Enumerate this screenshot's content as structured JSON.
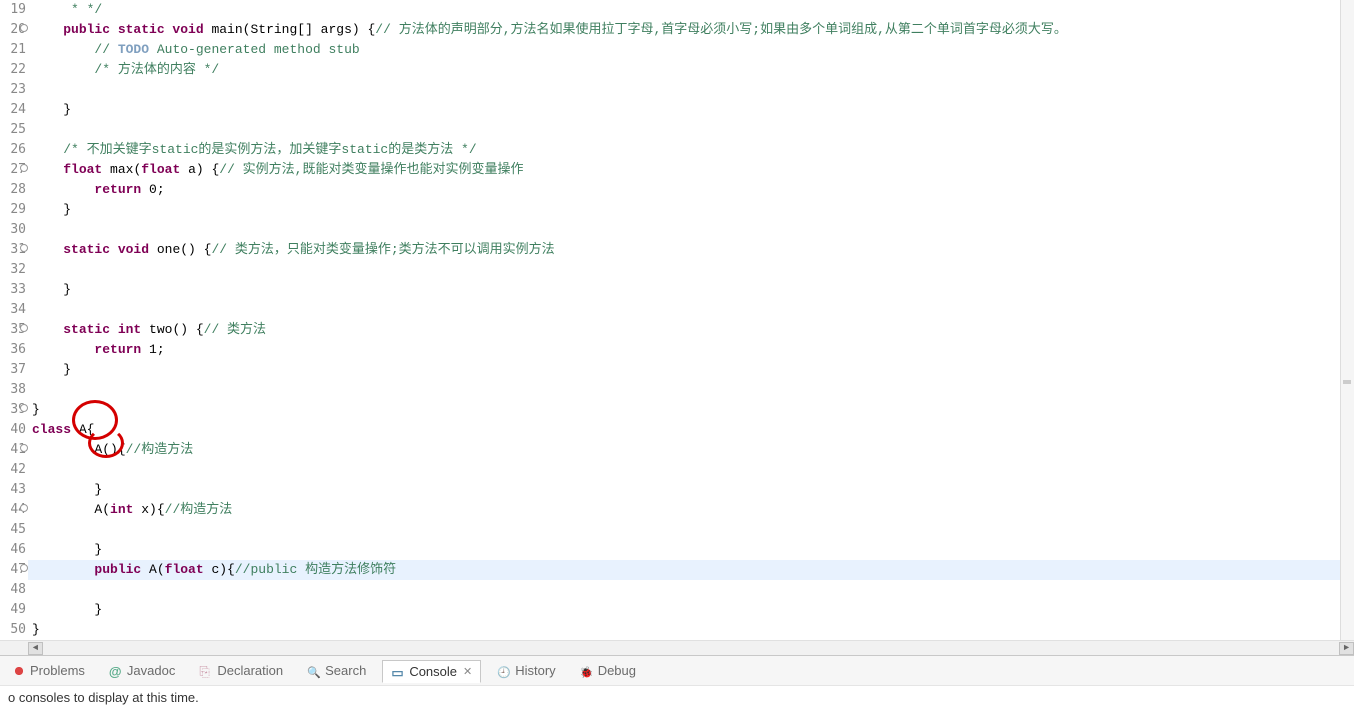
{
  "gutter": {
    "start": 19,
    "end": 50,
    "annotations": [
      20,
      27,
      31,
      35,
      39,
      41,
      44,
      47
    ]
  },
  "code": {
    "lines": [
      {
        "n": 19,
        "seg": [
          {
            "t": "     * */",
            "c": "cm"
          }
        ]
      },
      {
        "n": 20,
        "seg": [
          {
            "t": "    ",
            "c": "plain"
          },
          {
            "t": "public static void",
            "c": "kw"
          },
          {
            "t": " main(String[] args) {",
            "c": "plain"
          },
          {
            "t": "// 方法体的声明部分,方法名如果使用拉丁字母,首字母必须小写;如果由多个单词组成,从第二个单词首字母必须大写。",
            "c": "cm"
          }
        ]
      },
      {
        "n": 21,
        "seg": [
          {
            "t": "        ",
            "c": "plain"
          },
          {
            "t": "// ",
            "c": "cm"
          },
          {
            "t": "TODO",
            "c": "todo"
          },
          {
            "t": " Auto-generated method stub",
            "c": "cm"
          }
        ]
      },
      {
        "n": 22,
        "seg": [
          {
            "t": "        ",
            "c": "plain"
          },
          {
            "t": "/* 方法体的内容 */",
            "c": "cm"
          }
        ]
      },
      {
        "n": 23,
        "seg": [
          {
            "t": "",
            "c": "plain"
          }
        ]
      },
      {
        "n": 24,
        "seg": [
          {
            "t": "    }",
            "c": "plain"
          }
        ]
      },
      {
        "n": 25,
        "seg": [
          {
            "t": "",
            "c": "plain"
          }
        ]
      },
      {
        "n": 26,
        "seg": [
          {
            "t": "    ",
            "c": "plain"
          },
          {
            "t": "/* 不加关键字static的是实例方法，加关键字static的是类方法 */",
            "c": "cm"
          }
        ]
      },
      {
        "n": 27,
        "seg": [
          {
            "t": "    ",
            "c": "plain"
          },
          {
            "t": "float",
            "c": "kw"
          },
          {
            "t": " max(",
            "c": "plain"
          },
          {
            "t": "float",
            "c": "kw"
          },
          {
            "t": " a) {",
            "c": "plain"
          },
          {
            "t": "// 实例方法,既能对类变量操作也能对实例变量操作",
            "c": "cm"
          }
        ]
      },
      {
        "n": 28,
        "seg": [
          {
            "t": "        ",
            "c": "plain"
          },
          {
            "t": "return",
            "c": "kw"
          },
          {
            "t": " 0;",
            "c": "plain"
          }
        ]
      },
      {
        "n": 29,
        "seg": [
          {
            "t": "    }",
            "c": "plain"
          }
        ]
      },
      {
        "n": 30,
        "seg": [
          {
            "t": "",
            "c": "plain"
          }
        ]
      },
      {
        "n": 31,
        "seg": [
          {
            "t": "    ",
            "c": "plain"
          },
          {
            "t": "static void",
            "c": "kw"
          },
          {
            "t": " one() {",
            "c": "plain"
          },
          {
            "t": "// 类方法，只能对类变量操作;类方法不可以调用实例方法",
            "c": "cm"
          }
        ]
      },
      {
        "n": 32,
        "seg": [
          {
            "t": "",
            "c": "plain"
          }
        ]
      },
      {
        "n": 33,
        "seg": [
          {
            "t": "    }",
            "c": "plain"
          }
        ]
      },
      {
        "n": 34,
        "seg": [
          {
            "t": "",
            "c": "plain"
          }
        ]
      },
      {
        "n": 35,
        "seg": [
          {
            "t": "    ",
            "c": "plain"
          },
          {
            "t": "static int",
            "c": "kw"
          },
          {
            "t": " two() {",
            "c": "plain"
          },
          {
            "t": "// 类方法",
            "c": "cm"
          }
        ]
      },
      {
        "n": 36,
        "seg": [
          {
            "t": "        ",
            "c": "plain"
          },
          {
            "t": "return",
            "c": "kw"
          },
          {
            "t": " 1;",
            "c": "plain"
          }
        ]
      },
      {
        "n": 37,
        "seg": [
          {
            "t": "    }",
            "c": "plain"
          }
        ]
      },
      {
        "n": 38,
        "seg": [
          {
            "t": "",
            "c": "plain"
          }
        ]
      },
      {
        "n": 39,
        "seg": [
          {
            "t": "}",
            "c": "plain"
          }
        ]
      },
      {
        "n": 40,
        "seg": [
          {
            "t": "class",
            "c": "kw"
          },
          {
            "t": " A{",
            "c": "plain"
          }
        ]
      },
      {
        "n": 41,
        "seg": [
          {
            "t": "        A(){",
            "c": "plain"
          },
          {
            "t": "//构造方法",
            "c": "cm"
          }
        ]
      },
      {
        "n": 42,
        "seg": [
          {
            "t": "",
            "c": "plain"
          }
        ]
      },
      {
        "n": 43,
        "seg": [
          {
            "t": "        }",
            "c": "plain"
          }
        ]
      },
      {
        "n": 44,
        "seg": [
          {
            "t": "        A(",
            "c": "plain"
          },
          {
            "t": "int",
            "c": "kw"
          },
          {
            "t": " x){",
            "c": "plain"
          },
          {
            "t": "//构造方法",
            "c": "cm"
          }
        ]
      },
      {
        "n": 45,
        "seg": [
          {
            "t": "",
            "c": "plain"
          }
        ]
      },
      {
        "n": 46,
        "seg": [
          {
            "t": "        }",
            "c": "plain"
          }
        ]
      },
      {
        "n": 47,
        "hl": true,
        "seg": [
          {
            "t": "        ",
            "c": "plain"
          },
          {
            "t": "public",
            "c": "kw"
          },
          {
            "t": " A(",
            "c": "plain"
          },
          {
            "t": "float",
            "c": "kw"
          },
          {
            "t": " c){",
            "c": "plain"
          },
          {
            "t": "//public 构造方法修饰符",
            "c": "cm"
          }
        ]
      },
      {
        "n": 48,
        "seg": [
          {
            "t": "",
            "c": "plain"
          }
        ]
      },
      {
        "n": 49,
        "seg": [
          {
            "t": "        }",
            "c": "plain"
          }
        ]
      },
      {
        "n": 50,
        "seg": [
          {
            "t": "}",
            "c": "plain"
          }
        ]
      }
    ]
  },
  "tabs": {
    "items": [
      {
        "label": "Problems",
        "icon": "icon-problems"
      },
      {
        "label": "Javadoc",
        "icon": "icon-javadoc"
      },
      {
        "label": "Declaration",
        "icon": "icon-declaration"
      },
      {
        "label": "Search",
        "icon": "icon-search"
      },
      {
        "label": "Console",
        "icon": "icon-console",
        "active": true,
        "closable": true
      },
      {
        "label": "History",
        "icon": "icon-history"
      },
      {
        "label": "Debug",
        "icon": "icon-debug"
      }
    ]
  },
  "console": {
    "message": "o consoles to display at this time."
  }
}
